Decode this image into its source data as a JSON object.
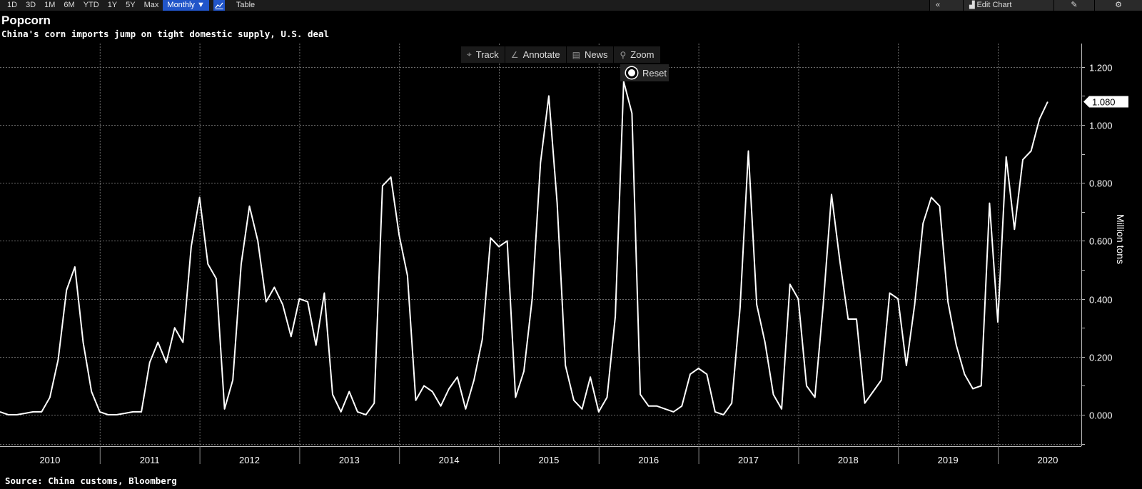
{
  "toolbar": {
    "ranges": [
      "1D",
      "3D",
      "1M",
      "6M",
      "YTD",
      "1Y",
      "5Y",
      "Max"
    ],
    "period": "Monthly ▼",
    "chart_icon": "line-chart-icon",
    "table": "Table",
    "collapse": "«",
    "edit_chart": "Edit Chart",
    "annotate_icon": "edit-icon",
    "settings": "⚙"
  },
  "controls": {
    "track": "Track",
    "annotate": "Annotate",
    "news": "News",
    "zoom": "Zoom",
    "reset": "Reset"
  },
  "last_value_label": "1.080",
  "chart_data": {
    "type": "line",
    "title": "Popcorn",
    "subtitle": "China's corn imports jump on tight domestic supply, U.S. deal",
    "source": "Source: China customs, Bloomberg",
    "ylabel": "Million tons",
    "ylim": [
      -0.1,
      1.28
    ],
    "yticks": [
      "0.000",
      "0.200",
      "0.400",
      "0.600",
      "0.800",
      "1.000",
      "1.200"
    ],
    "x_start": "2010-01",
    "x_end": "2020-12",
    "year_labels": [
      "2010",
      "2011",
      "2012",
      "2013",
      "2014",
      "2015",
      "2016",
      "2017",
      "2018",
      "2019",
      "2020"
    ],
    "color": "#ffffff",
    "grid": true,
    "series": [
      {
        "values": [
          0.01,
          0.0,
          0.0,
          0.005,
          0.01,
          0.01,
          0.06,
          0.19,
          0.43,
          0.51,
          0.25,
          0.08,
          0.01,
          0.0,
          0.0,
          0.005,
          0.01,
          0.01,
          0.18,
          0.25,
          0.18,
          0.3,
          0.25,
          0.58,
          0.75,
          0.52,
          0.47,
          0.02,
          0.12,
          0.52,
          0.72,
          0.6,
          0.39,
          0.44,
          0.38,
          0.27,
          0.4,
          0.39,
          0.24,
          0.42,
          0.07,
          0.01,
          0.08,
          0.01,
          0.0,
          0.04,
          0.79,
          0.82,
          0.62,
          0.48,
          0.05,
          0.1,
          0.08,
          0.03,
          0.09,
          0.13,
          0.02,
          0.12,
          0.26,
          0.61,
          0.58,
          0.6,
          0.06,
          0.15,
          0.4,
          0.87,
          1.1,
          0.73,
          0.17,
          0.05,
          0.02,
          0.13,
          0.01,
          0.06,
          0.34,
          1.15,
          1.04,
          0.07,
          0.03,
          0.03,
          0.02,
          0.01,
          0.03,
          0.14,
          0.16,
          0.14,
          0.01,
          0.0,
          0.04,
          0.37,
          0.91,
          0.38,
          0.25,
          0.07,
          0.02,
          0.45,
          0.4,
          0.1,
          0.06,
          0.38,
          0.76,
          0.53,
          0.33,
          0.33,
          0.04,
          0.08,
          0.12,
          0.42,
          0.4,
          0.17,
          0.38,
          0.66,
          0.75,
          0.72,
          0.39,
          0.24,
          0.14,
          0.09,
          0.1,
          0.73,
          0.32,
          0.89,
          0.64,
          0.88,
          0.91,
          1.02,
          1.08
        ]
      }
    ]
  }
}
